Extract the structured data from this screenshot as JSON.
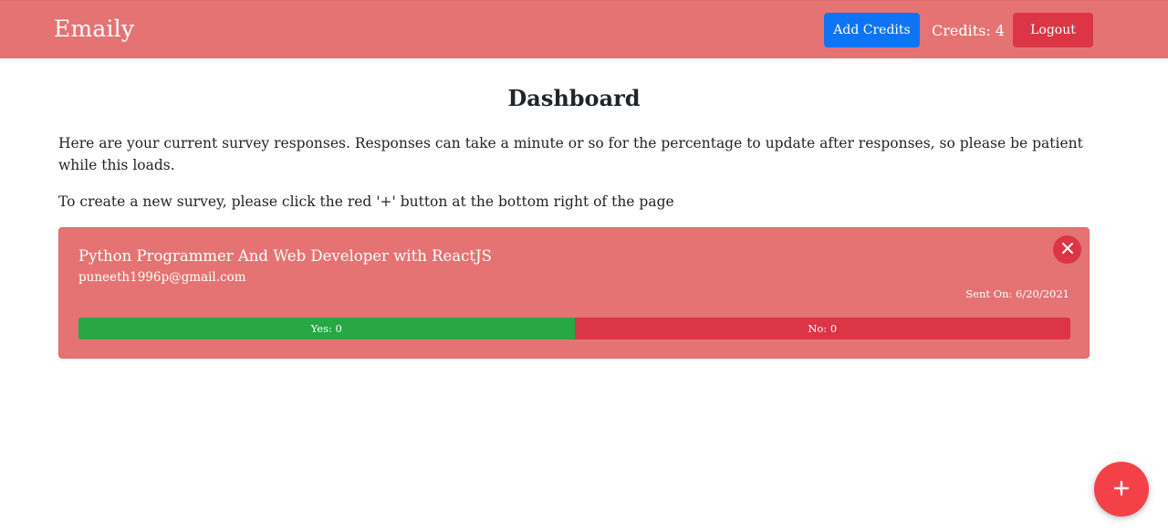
{
  "navbar": {
    "brand": "Emaily",
    "add_credits_label": "Add Credits",
    "credits_text": "Credits: 4",
    "logout_label": "Logout",
    "background_color": "#e57373"
  },
  "main": {
    "title": "Dashboard",
    "intro_text": "Here are your current survey responses. Responses can take a minute or so for the percentage to update after responses, so please be patient while this loads.",
    "hint_text": "To create a new survey, please click the red '+' button at the bottom right of the page"
  },
  "surveys": [
    {
      "title": "Python Programmer And Web Developer with ReactJS",
      "email": "puneeth1996p@gmail.com",
      "sent_on": "Sent On: 6/20/2021",
      "yes_label": "Yes: 0",
      "no_label": "No: 0",
      "yes_fraction": 0.5,
      "close_icon": "close-icon"
    }
  ],
  "fab": {
    "icon": "plus-icon",
    "color": "#f44148"
  }
}
